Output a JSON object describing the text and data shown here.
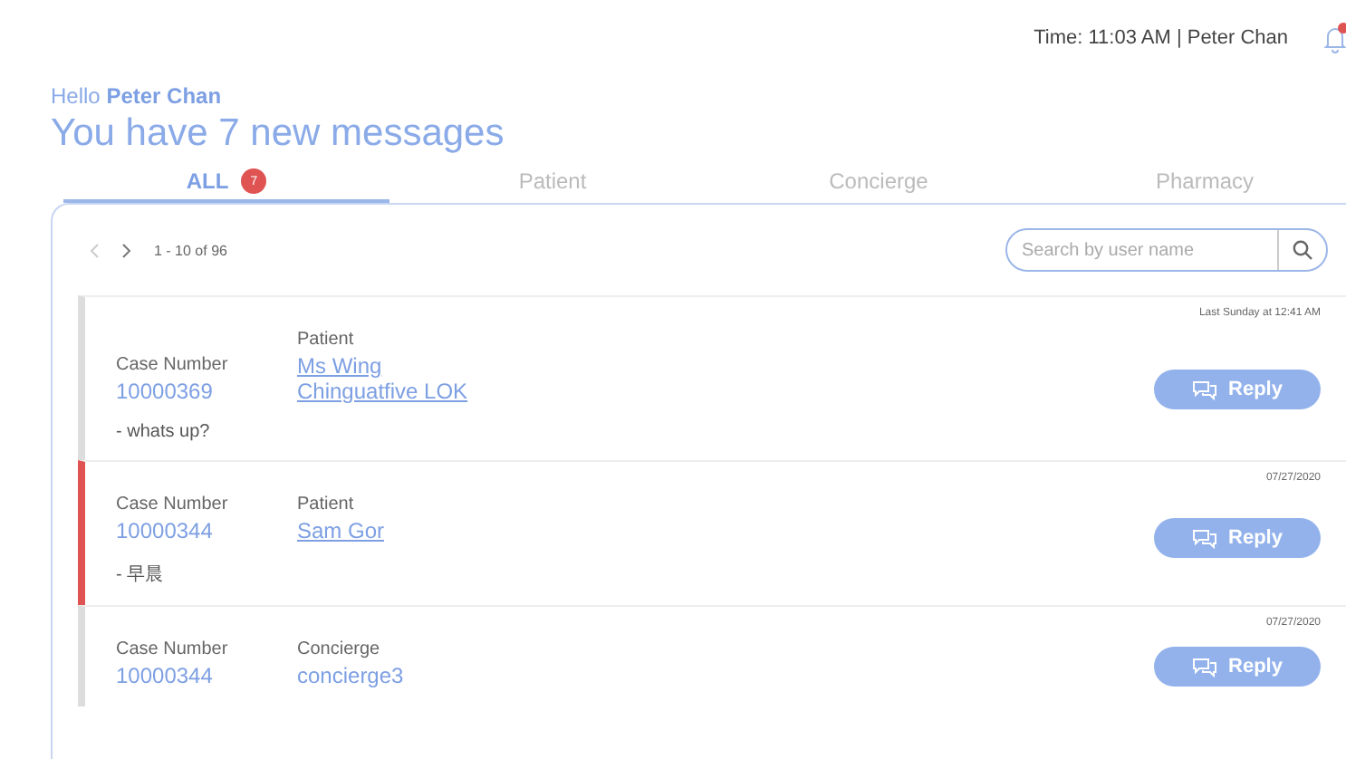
{
  "header": {
    "status": "Time: 11:03 AM | Peter Chan",
    "notification": true
  },
  "greeting": {
    "prefix": "Hello",
    "name": "Peter Chan"
  },
  "title": "You have 7 new messages",
  "tabs": [
    {
      "label": "ALL",
      "badge": "7",
      "selected": true
    },
    {
      "label": "Patient",
      "selected": false
    },
    {
      "label": "Concierge",
      "selected": false
    },
    {
      "label": "Pharmacy",
      "selected": false
    }
  ],
  "pager": {
    "range": "1 - 10 of 96"
  },
  "search": {
    "placeholder": "Search by user name"
  },
  "messages": [
    {
      "case_label": "Case Number",
      "case_number": "10000369",
      "role": "Patient",
      "names": [
        "Ms Wing",
        "Chinguatfive LOK"
      ],
      "link": true,
      "text": "- whats up?",
      "time": "Last Sunday at 12:41 AM",
      "flagged": false,
      "action": "Reply"
    },
    {
      "case_label": "Case Number",
      "case_number": "10000344",
      "role": "Patient",
      "names": [
        "Sam Gor"
      ],
      "link": true,
      "text": "- 早晨",
      "time": "07/27/2020",
      "flagged": true,
      "action": "Reply"
    },
    {
      "case_label": "Case Number",
      "case_number": "10000344",
      "role": "Concierge",
      "names": [
        "concierge3"
      ],
      "link": false,
      "time": "07/27/2020",
      "flagged": false,
      "action": "Reply"
    }
  ]
}
